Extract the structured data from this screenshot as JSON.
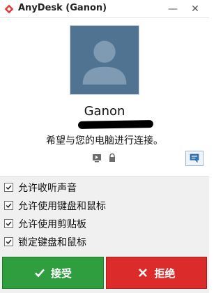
{
  "window": {
    "title": "AnyDesk (Ganon)",
    "minimize_glyph": "—",
    "close_glyph": "✕"
  },
  "colors": {
    "accept": "#2e9e3e",
    "reject": "#dc2b2b",
    "avatar_bg": "#4f7391",
    "brand": "#e53935"
  },
  "user": {
    "name": "Ganon",
    "message": "希望与您的电脑进行连接。"
  },
  "status_icons": [
    "screen-play-icon",
    "lock-icon"
  ],
  "options": [
    {
      "label": "允许收听声音",
      "checked": true
    },
    {
      "label": "允许使用键盘和鼠标",
      "checked": true
    },
    {
      "label": "允许使用剪贴板",
      "checked": true
    },
    {
      "label": "锁定键盘和鼠标",
      "checked": true
    }
  ],
  "buttons": {
    "accept": "接受",
    "reject": "拒绝"
  }
}
